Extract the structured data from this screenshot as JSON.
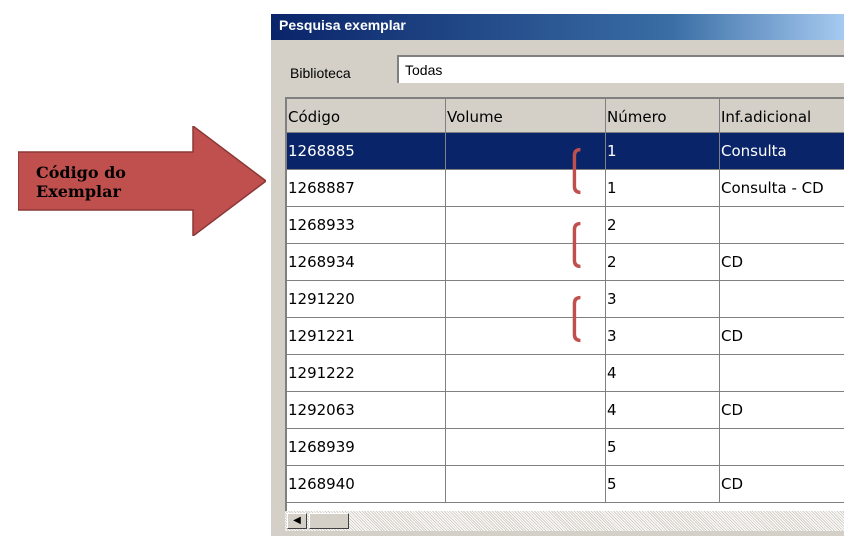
{
  "annotation": {
    "label_line1": "Código do",
    "label_line2": "Exemplar",
    "arrow_color": "#c0504d"
  },
  "window": {
    "title": "Pesquisa exemplar"
  },
  "library": {
    "label": "Biblioteca",
    "value": "Todas"
  },
  "grid": {
    "columns": [
      "Código",
      "Volume",
      "Número",
      "Inf.adicional"
    ],
    "rows": [
      {
        "codigo": "1268885",
        "volume": "",
        "numero": "1",
        "info": "Consulta"
      },
      {
        "codigo": "1268887",
        "volume": "",
        "numero": "1",
        "info": "Consulta - CD"
      },
      {
        "codigo": "1268933",
        "volume": "",
        "numero": "2",
        "info": ""
      },
      {
        "codigo": "1268934",
        "volume": "",
        "numero": "2",
        "info": "CD"
      },
      {
        "codigo": "1291220",
        "volume": "",
        "numero": "3",
        "info": ""
      },
      {
        "codigo": "1291221",
        "volume": "",
        "numero": "3",
        "info": "CD"
      },
      {
        "codigo": "1291222",
        "volume": "",
        "numero": "4",
        "info": ""
      },
      {
        "codigo": "1292063",
        "volume": "",
        "numero": "4",
        "info": "CD"
      },
      {
        "codigo": "1268939",
        "volume": "",
        "numero": "5",
        "info": ""
      },
      {
        "codigo": "1268940",
        "volume": "",
        "numero": "5",
        "info": "CD"
      }
    ],
    "selected_row": 0
  },
  "scrollbar": {
    "left_icon": "arrow-left-icon"
  }
}
